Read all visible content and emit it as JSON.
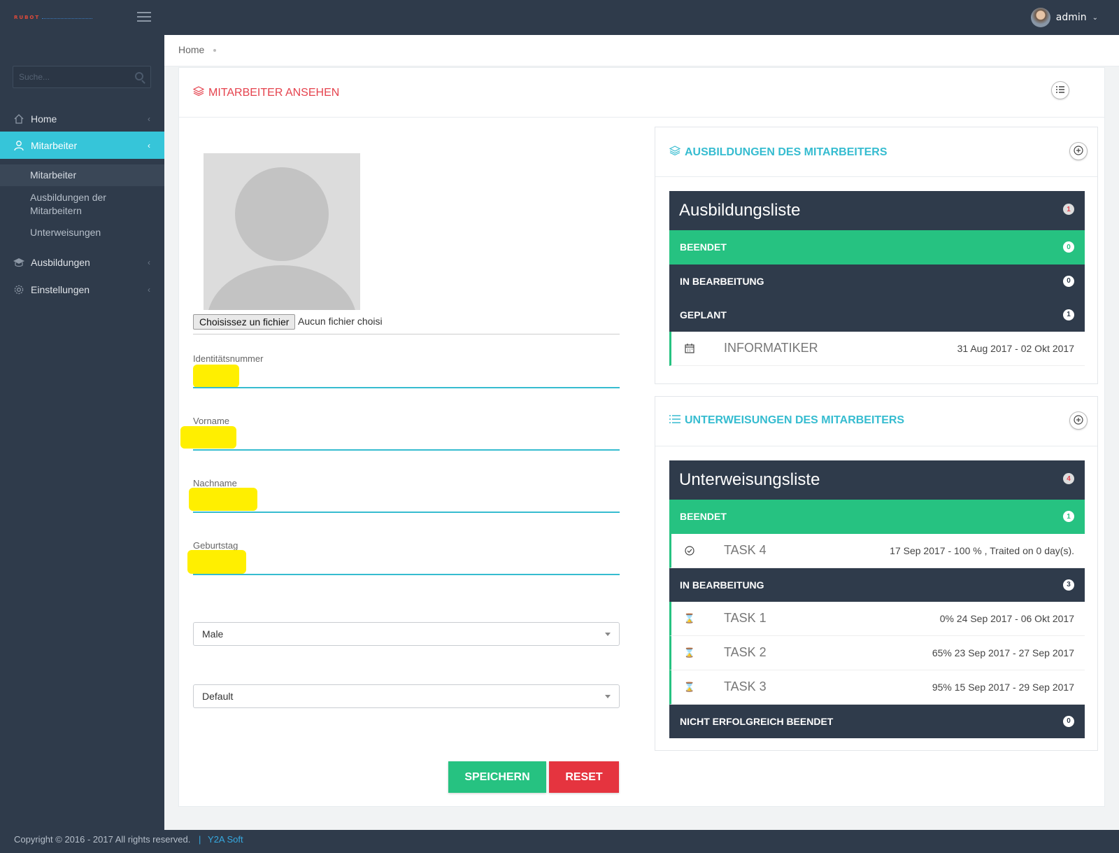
{
  "topbar": {
    "brand": "RUBOT",
    "user": "admin"
  },
  "sidebar": {
    "search_placeholder": "Suche...",
    "items": [
      {
        "label": "Home",
        "icon": "home-icon"
      },
      {
        "label": "Mitarbeiter",
        "icon": "user-icon",
        "active": true
      },
      {
        "label": "Ausbildungen",
        "icon": "graduation-cap-icon"
      },
      {
        "label": "Einstellungen",
        "icon": "gear-icon"
      }
    ],
    "subitems": [
      {
        "label": "Mitarbeiter"
      },
      {
        "label": "Ausbildungen der Mitarbeitern"
      },
      {
        "label": "Unterweisungen"
      }
    ]
  },
  "breadcrumb": {
    "home": "Home"
  },
  "page": {
    "title": "MITARBEITER ANSEHEN",
    "file_button": "Choisissez un fichier",
    "file_status": "Aucun fichier choisi",
    "fields": {
      "id_label": "Identitätsnummer",
      "firstname_label": "Vorname",
      "lastname_label": "Nachname",
      "birthday_label": "Geburtstag"
    },
    "gender_select": "Male",
    "group_select": "Default",
    "save_label": "SPEICHERN",
    "reset_label": "RESET"
  },
  "trainings": {
    "panel_title": "AUSBILDUNGEN DES MITARBEITERS",
    "list_title": "Ausbildungsliste",
    "list_count": "1",
    "groups": {
      "done": {
        "label": "BEENDET",
        "count": "0"
      },
      "in_progress": {
        "label": "IN BEARBEITUNG",
        "count": "0"
      },
      "planned": {
        "label": "GEPLANT",
        "count": "1"
      }
    },
    "items": [
      {
        "name": "INFORMATIKER",
        "dates": "31 Aug 2017 - 02 Okt 2017"
      }
    ]
  },
  "instructions": {
    "panel_title": "UNTERWEISUNGEN DES MITARBEITERS",
    "list_title": "Unterweisungsliste",
    "list_count": "4",
    "groups": {
      "done": {
        "label": "BEENDET",
        "count": "1"
      },
      "in_progress": {
        "label": "IN BEARBEITUNG",
        "count": "3"
      },
      "failed": {
        "label": "NICHT ERFOLGREICH BEENDET",
        "count": "0"
      }
    },
    "done_items": [
      {
        "name": "TASK 4",
        "info": "17 Sep 2017 - 100 % , Traited on 0 day(s)."
      }
    ],
    "progress_items": [
      {
        "name": "TASK 1",
        "info": "0% 24 Sep 2017 - 06 Okt 2017"
      },
      {
        "name": "TASK 2",
        "info": "65% 23 Sep 2017 - 27 Sep 2017"
      },
      {
        "name": "TASK 3",
        "info": "95% 15 Sep 2017 - 29 Sep 2017"
      }
    ]
  },
  "footer": {
    "copyright": "Copyright © 2016 - 2017 All rights reserved.",
    "separator": "|",
    "company": "Y2A Soft"
  },
  "colors": {
    "dark": "#2f3b4b",
    "accent": "#36c5d9",
    "title_red": "#e5434e",
    "green": "#26c281"
  }
}
